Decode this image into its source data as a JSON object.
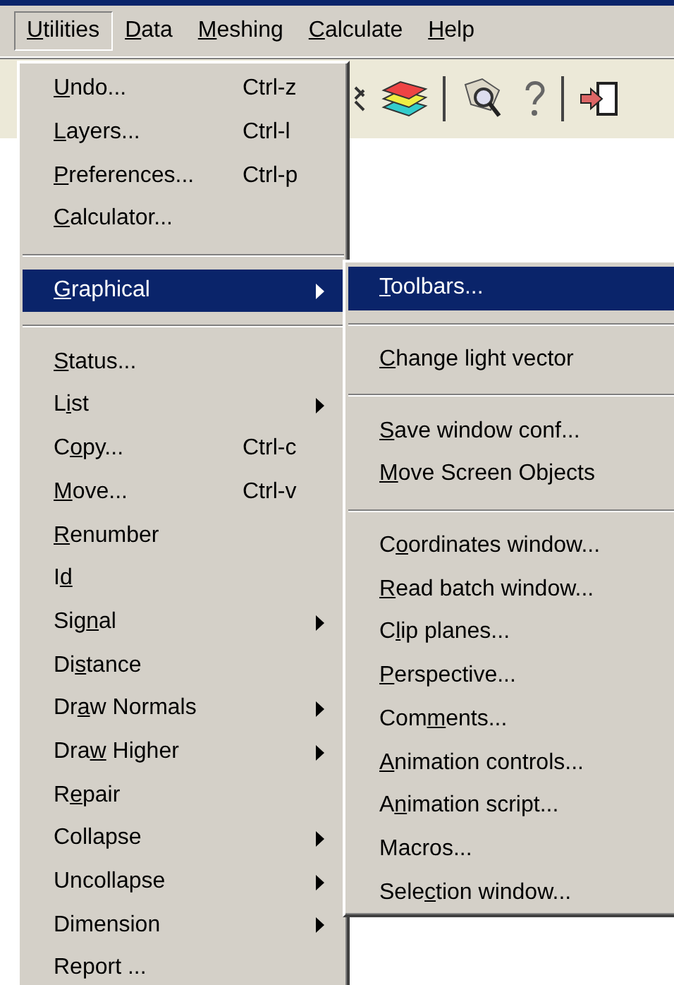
{
  "menubar": [
    {
      "key": "U",
      "post": "tilities",
      "selected": true
    },
    {
      "key": "D",
      "post": "ata",
      "selected": false
    },
    {
      "key": "M",
      "post": "eshing",
      "selected": false
    },
    {
      "key": "C",
      "post": "alculate",
      "selected": false
    },
    {
      "key": "H",
      "post": "elp",
      "selected": false
    }
  ],
  "utilities_menu": {
    "items": [
      {
        "kind": "item",
        "key": "U",
        "post": "ndo...",
        "shortcut": "Ctrl-z",
        "has_submenu": false,
        "selected": false
      },
      {
        "kind": "item",
        "key": "L",
        "post": "ayers...",
        "shortcut": "Ctrl-l",
        "has_submenu": false,
        "selected": false
      },
      {
        "kind": "item",
        "key": "P",
        "post": "references...",
        "shortcut": "Ctrl-p",
        "has_submenu": false,
        "selected": false
      },
      {
        "kind": "item",
        "key": "C",
        "post": "alculator...",
        "has_submenu": false,
        "selected": false
      },
      {
        "kind": "separator"
      },
      {
        "kind": "item",
        "key": "G",
        "post": "raphical",
        "has_submenu": true,
        "selected": true
      },
      {
        "kind": "separator"
      },
      {
        "kind": "item",
        "key": "S",
        "post": "tatus...",
        "has_submenu": false,
        "selected": false
      },
      {
        "kind": "item",
        "pre": "L",
        "key": "i",
        "post": "st",
        "has_submenu": true,
        "selected": false
      },
      {
        "kind": "item",
        "pre": "C",
        "key": "o",
        "post": "py...",
        "shortcut": "Ctrl-c",
        "has_submenu": false,
        "selected": false
      },
      {
        "kind": "item",
        "key": "M",
        "post": "ove...",
        "shortcut": "Ctrl-v",
        "has_submenu": false,
        "selected": false
      },
      {
        "kind": "item",
        "key": "R",
        "post": "enumber",
        "has_submenu": false,
        "selected": false
      },
      {
        "kind": "item",
        "pre": "I",
        "key": "d",
        "has_submenu": false,
        "selected": false
      },
      {
        "kind": "item",
        "pre": "Sig",
        "key": "n",
        "post": "al",
        "has_submenu": true,
        "selected": false
      },
      {
        "kind": "item",
        "pre": "Di",
        "key": "s",
        "post": "tance",
        "has_submenu": false,
        "selected": false
      },
      {
        "kind": "item",
        "pre": "Dr",
        "key": "a",
        "post": "w Normals",
        "has_submenu": true,
        "selected": false
      },
      {
        "kind": "item",
        "pre": "Dra",
        "key": "w",
        "post": " Higher",
        "has_submenu": true,
        "selected": false
      },
      {
        "kind": "item",
        "pre": "R",
        "key": "e",
        "post": "pair",
        "has_submenu": false,
        "selected": false
      },
      {
        "kind": "item",
        "pre": "Collapse",
        "has_submenu": true,
        "selected": false
      },
      {
        "kind": "item",
        "pre": "Uncollapse",
        "has_submenu": true,
        "selected": false
      },
      {
        "kind": "item",
        "pre": "Dimension",
        "has_submenu": true,
        "selected": false
      },
      {
        "kind": "item",
        "pre": "Report ...",
        "has_submenu": false,
        "selected": false
      }
    ]
  },
  "graphical_submenu": {
    "items": [
      {
        "kind": "item",
        "key": "T",
        "post": "oolbars...",
        "selected": true
      },
      {
        "kind": "separator"
      },
      {
        "kind": "item",
        "key": "C",
        "post": "hange light vector",
        "selected": false
      },
      {
        "kind": "separator"
      },
      {
        "kind": "item",
        "key": "S",
        "post": "ave window conf...",
        "selected": false
      },
      {
        "kind": "item",
        "key": "M",
        "post": "ove Screen Objects",
        "selected": false
      },
      {
        "kind": "separator"
      },
      {
        "kind": "item",
        "pre": "C",
        "key": "o",
        "post": "ordinates window...",
        "selected": false
      },
      {
        "kind": "item",
        "key": "R",
        "post": "ead batch window...",
        "selected": false
      },
      {
        "kind": "item",
        "pre": "C",
        "key": "l",
        "post": "ip planes...",
        "selected": false
      },
      {
        "kind": "item",
        "key": "P",
        "post": "erspective...",
        "selected": false
      },
      {
        "kind": "item",
        "pre": "Com",
        "key": "m",
        "post": "ents...",
        "selected": false
      },
      {
        "kind": "item",
        "key": "A",
        "post": "nimation controls...",
        "selected": false
      },
      {
        "kind": "item",
        "pre": "A",
        "key": "n",
        "post": "imation script...",
        "selected": false
      },
      {
        "kind": "item",
        "pre": "Macros...",
        "selected": false
      },
      {
        "kind": "item",
        "pre": "Sele",
        "key": "c",
        "post": "tion window...",
        "selected": false
      }
    ]
  }
}
